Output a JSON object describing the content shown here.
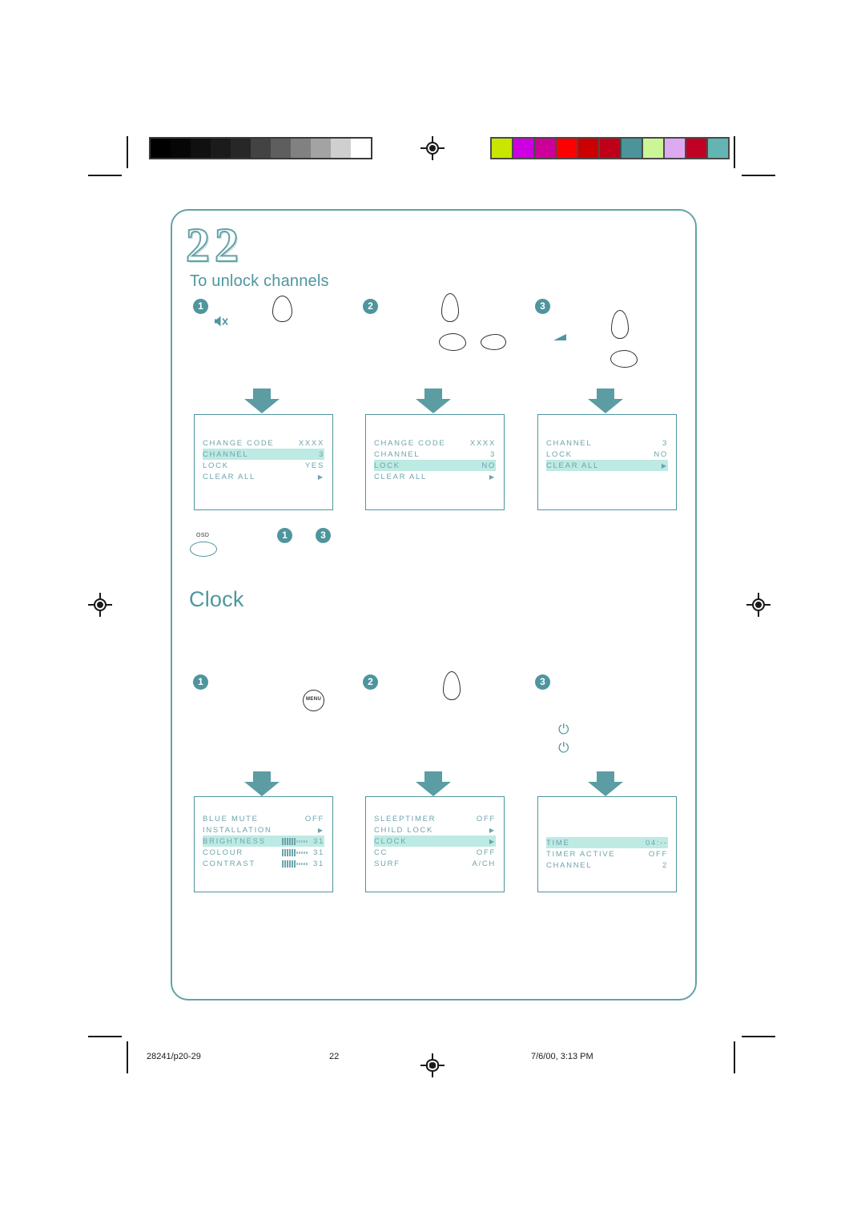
{
  "document": {
    "chapter_number": "22",
    "section1_title": "To unlock channels",
    "section2_title": "Clock"
  },
  "calibration": {
    "grey_swatches": [
      "#000000",
      "#060606",
      "#101010",
      "#1b1b1b",
      "#272727",
      "#434343",
      "#5e5e5e",
      "#818181",
      "#a3a3a3",
      "#cfcfcf",
      "#ffffff"
    ],
    "color_swatches": [
      "#c8e600",
      "#cc00e0",
      "#cc0099",
      "#ff0000",
      "#cc0000",
      "#c00018",
      "#4c939b",
      "#ccf596",
      "#ddaaf2",
      "#c00024",
      "#63b5b3"
    ]
  },
  "keys": {
    "osd_label": "OSD",
    "menu_label": "MENU"
  },
  "icons": {
    "mute": "mute-icon",
    "volume": "volume-icon",
    "power": "⏻"
  },
  "steps": {
    "one": "1",
    "two": "2",
    "three": "3"
  },
  "osd_screens": [
    {
      "id": "unlock-step-1",
      "rows": [
        {
          "label": "CHANGE CODE",
          "value": "XXXX",
          "type": "value",
          "highlight": false
        },
        {
          "label": "CHANNEL",
          "value": "3",
          "type": "value",
          "highlight": true
        },
        {
          "label": "LOCK",
          "value": "YES",
          "type": "value",
          "highlight": false
        },
        {
          "label": "CLEAR ALL",
          "value": "▶",
          "type": "arrow",
          "highlight": false
        }
      ]
    },
    {
      "id": "unlock-step-2",
      "rows": [
        {
          "label": "CHANGE CODE",
          "value": "XXXX",
          "type": "value",
          "highlight": false
        },
        {
          "label": "CHANNEL",
          "value": "3",
          "type": "value",
          "highlight": false
        },
        {
          "label": "LOCK",
          "value": "NO",
          "type": "value",
          "highlight": true
        },
        {
          "label": "CLEAR ALL",
          "value": "▶",
          "type": "arrow",
          "highlight": false
        }
      ]
    },
    {
      "id": "unlock-step-3",
      "rows": [
        {
          "label": "CHANNEL",
          "value": "3",
          "type": "value",
          "highlight": false
        },
        {
          "label": "LOCK",
          "value": "NO",
          "type": "value",
          "highlight": false
        },
        {
          "label": "CLEAR ALL",
          "value": "▶",
          "type": "arrow",
          "highlight": true
        }
      ]
    },
    {
      "id": "clock-step-1",
      "rows": [
        {
          "label": "BLUE MUTE",
          "value": "OFF",
          "type": "value",
          "highlight": false
        },
        {
          "label": "INSTALLATION",
          "value": "▶",
          "type": "arrow",
          "highlight": false
        },
        {
          "label": "BRIGHTNESS",
          "value": "31",
          "type": "slider",
          "filled": 6,
          "empty": 5,
          "highlight": true
        },
        {
          "label": "COLOUR",
          "value": "31",
          "type": "slider",
          "filled": 6,
          "empty": 5,
          "highlight": false
        },
        {
          "label": "CONTRAST",
          "value": "31",
          "type": "slider",
          "filled": 6,
          "empty": 5,
          "highlight": false
        }
      ]
    },
    {
      "id": "clock-step-2",
      "rows": [
        {
          "label": "SLEEPTIMER",
          "value": "OFF",
          "type": "value",
          "highlight": false
        },
        {
          "label": "CHILD LOCK",
          "value": "▶",
          "type": "arrow",
          "highlight": false
        },
        {
          "label": "CLOCK",
          "value": "▶",
          "type": "arrow",
          "highlight": true
        },
        {
          "label": "CC",
          "value": "OFF",
          "type": "value",
          "highlight": false
        },
        {
          "label": "SURF",
          "value": "A/CH",
          "type": "value",
          "highlight": false
        }
      ]
    },
    {
      "id": "clock-step-3",
      "rows": [
        {
          "label": "TIME",
          "value": "04:--",
          "type": "value",
          "highlight": true
        },
        {
          "label": "TIMER ACTIVE",
          "value": "OFF",
          "type": "value",
          "highlight": false
        },
        {
          "label": "CHANNEL",
          "value": "2",
          "type": "value",
          "highlight": false
        }
      ]
    }
  ],
  "footer": {
    "job_ref": "28241/p20-29",
    "page_number": "22",
    "timestamp": "7/6/00, 3:13 PM"
  },
  "colors": {
    "teal": "#4e959d",
    "teal_light": "#6ea3ad",
    "highlight": "#bdeae3",
    "border": "#63a2a8"
  }
}
